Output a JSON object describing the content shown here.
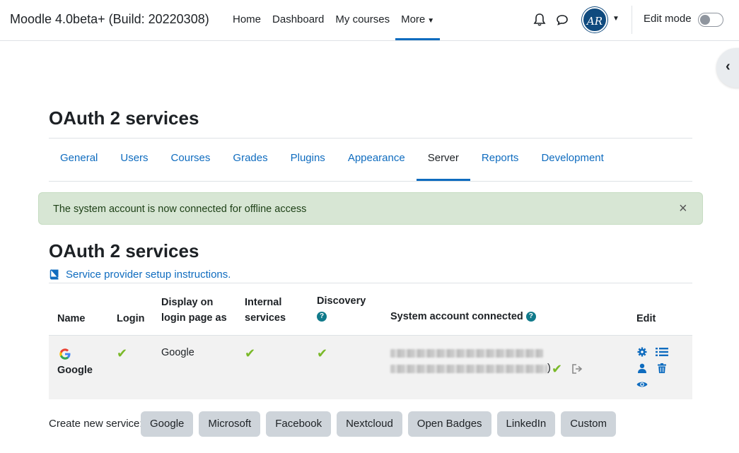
{
  "navbar": {
    "brand": "Moodle 4.0beta+ (Build: 20220308)",
    "links": [
      "Home",
      "Dashboard",
      "My courses",
      "More"
    ],
    "active_link": "More",
    "avatar_initials": "AR",
    "edit_mode_label": "Edit mode",
    "edit_mode_on": false
  },
  "page": {
    "title": "OAuth 2 services",
    "tabs": [
      "General",
      "Users",
      "Courses",
      "Grades",
      "Plugins",
      "Appearance",
      "Server",
      "Reports",
      "Development"
    ],
    "active_tab": "Server",
    "alert": "The system account is now connected for offline access",
    "alert_close": "×",
    "section_title": "OAuth 2 services",
    "setup_link": "Service provider setup instructions."
  },
  "table": {
    "headers": {
      "name": "Name",
      "login": "Login",
      "display_1": "Display on",
      "display_2": "login page as",
      "internal_1": "Internal",
      "internal_2": "services",
      "discovery": "Discovery",
      "system": "System account connected",
      "edit": "Edit"
    },
    "rows": [
      {
        "name": "Google",
        "login": true,
        "display_name": "Google",
        "internal": true,
        "discovery": true,
        "system_account_suffix": ")",
        "system_connected": true
      }
    ]
  },
  "create": {
    "label": "Create new service:",
    "buttons": [
      "Google",
      "Microsoft",
      "Facebook",
      "Nextcloud",
      "Open Badges",
      "LinkedIn",
      "Custom"
    ]
  },
  "colors": {
    "link": "#0f6cbf",
    "alert_bg": "#d7e6d4",
    "check": "#7ab929",
    "help": "#117a8b"
  },
  "icons": [
    "bell-icon",
    "chat-icon",
    "book-icon",
    "google-logo",
    "check-icon",
    "logout-icon",
    "gear-icon",
    "list-icon",
    "user-icon",
    "trash-icon",
    "eye-icon",
    "question-icon"
  ]
}
